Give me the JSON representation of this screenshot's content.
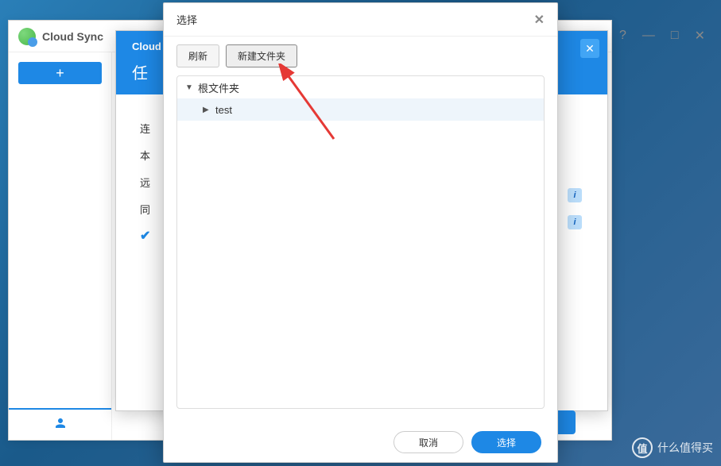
{
  "bg_window": {
    "help": "?",
    "minimize": "—",
    "maximize": "□",
    "close": "✕"
  },
  "main_window": {
    "title": "Cloud Sync",
    "add_label": "+"
  },
  "wizard": {
    "brand": "Cloud",
    "title": "任",
    "close": "✕",
    "rows": {
      "r1": "连",
      "r2": "本",
      "r3": "远",
      "r4": "同",
      "check": "✔"
    },
    "info": "i"
  },
  "modal": {
    "title": "选择",
    "close": "✕",
    "toolbar": {
      "refresh": "刷新",
      "new_folder": "新建文件夹"
    },
    "tree": {
      "root": "根文件夹",
      "child1": "test"
    },
    "footer": {
      "cancel": "取消",
      "select": "选择"
    }
  },
  "watermark": {
    "icon": "值",
    "text": "什么值得买"
  }
}
